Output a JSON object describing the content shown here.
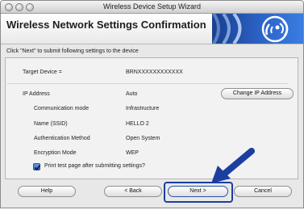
{
  "window": {
    "title": "Wireless Device Setup Wizard"
  },
  "header": {
    "title": "Wireless Network Settings Confirmation",
    "logo_icon": "wireless-signal-icon"
  },
  "instruction": "Click \"Next\" to submit following settings to the device",
  "settings": {
    "target_device_label": "Target Device =",
    "target_device_value": "BRNXXXXXXXXXXXX",
    "ip_address_label": "IP Address",
    "ip_address_value": "Auto",
    "change_ip_label": "Change IP Address",
    "rows": [
      {
        "label": "Communication mode",
        "value": "Infrastructure"
      },
      {
        "label": "Name (SSID)",
        "value": "HELLO 2"
      },
      {
        "label": "Authentication Method",
        "value": "Open System"
      },
      {
        "label": "Encryption Mode",
        "value": "WEP"
      }
    ],
    "print_test_page_label": "Print test page after submitting settings?",
    "print_test_page_checked": true
  },
  "buttons": {
    "help": "Help",
    "back": "< Back",
    "next": "Next >",
    "cancel": "Cancel"
  },
  "colors": {
    "accent": "#1b3f9e",
    "banner": "#2c64c8"
  }
}
